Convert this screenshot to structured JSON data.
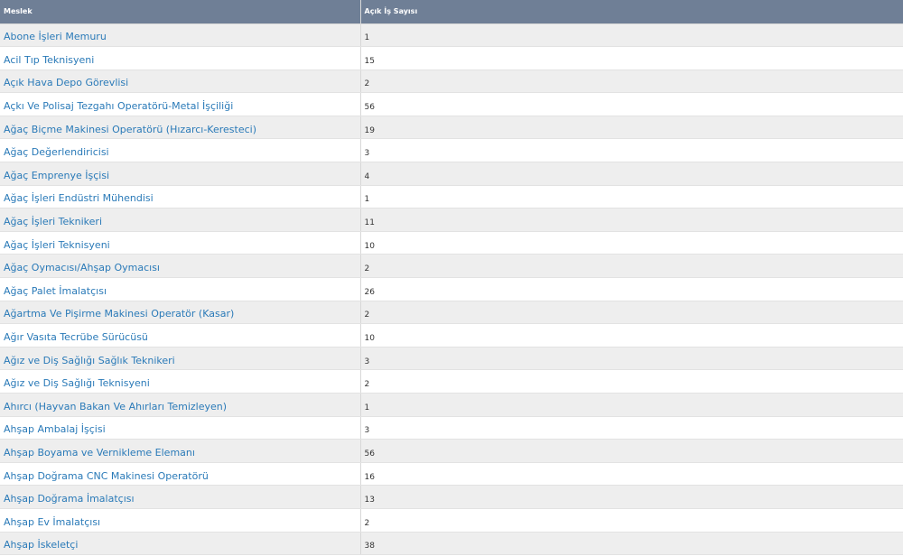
{
  "table": {
    "headers": [
      "Meslek",
      "Açık İş Sayısı"
    ],
    "rows": [
      {
        "meslek": "Abone İşleri Memuru",
        "count": "1"
      },
      {
        "meslek": "Acil Tıp Teknisyeni",
        "count": "15"
      },
      {
        "meslek": "Açık Hava Depo Görevlisi",
        "count": "2"
      },
      {
        "meslek": "Açkı Ve Polisaj Tezgahı Operatörü-Metal İşçiliği",
        "count": "56"
      },
      {
        "meslek": "Ağaç Biçme Makinesi Operatörü (Hızarcı-Keresteci)",
        "count": "19"
      },
      {
        "meslek": "Ağaç Değerlendiricisi",
        "count": "3"
      },
      {
        "meslek": "Ağaç Emprenye İşçisi",
        "count": "4"
      },
      {
        "meslek": "Ağaç İşleri Endüstri Mühendisi",
        "count": "1"
      },
      {
        "meslek": "Ağaç İşleri Teknikeri",
        "count": "11"
      },
      {
        "meslek": "Ağaç İşleri Teknisyeni",
        "count": "10"
      },
      {
        "meslek": "Ağaç Oymacısı/Ahşap Oymacısı",
        "count": "2"
      },
      {
        "meslek": "Ağaç Palet İmalatçısı",
        "count": "26"
      },
      {
        "meslek": "Ağartma Ve Pişirme Makinesi Operatör (Kasar)",
        "count": "2"
      },
      {
        "meslek": "Ağır Vasıta Tecrübe Sürücüsü",
        "count": "10"
      },
      {
        "meslek": "Ağız ve Diş Sağlığı Sağlık Teknikeri",
        "count": "3"
      },
      {
        "meslek": "Ağız ve Diş Sağlığı Teknisyeni",
        "count": "2"
      },
      {
        "meslek": "Ahırcı (Hayvan Bakan Ve Ahırları Temizleyen)",
        "count": "1"
      },
      {
        "meslek": "Ahşap Ambalaj İşçisi",
        "count": "3"
      },
      {
        "meslek": "Ahşap Boyama ve Vernikleme Elemanı",
        "count": "56"
      },
      {
        "meslek": "Ahşap Doğrama CNC Makinesi Operatörü",
        "count": "16"
      },
      {
        "meslek": "Ahşap Doğrama İmalatçısı",
        "count": "13"
      },
      {
        "meslek": "Ahşap Ev İmalatçısı",
        "count": "2"
      },
      {
        "meslek": "Ahşap İskeletçi",
        "count": "38"
      }
    ]
  },
  "colors": {
    "header_bg": "#6f7f96",
    "header_text": "#ffffff",
    "link": "#2a7ab8",
    "row_alt": "#eeeeee"
  }
}
